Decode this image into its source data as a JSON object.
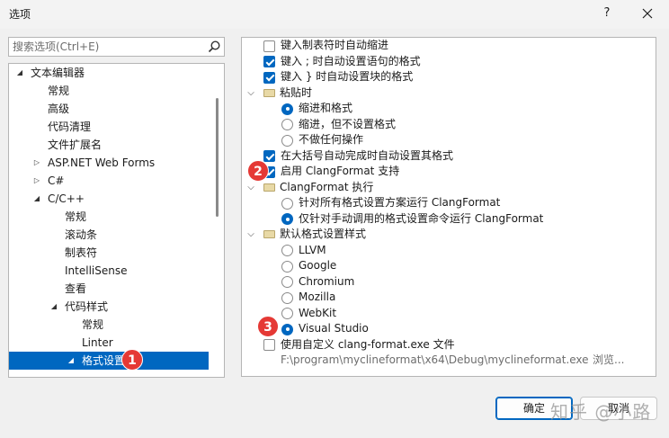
{
  "window": {
    "title": "选项",
    "help_glyph": "?",
    "close_icon": "close-icon"
  },
  "search": {
    "placeholder": "搜索选项(Ctrl+E)",
    "icon": "search-icon"
  },
  "tree": {
    "items": [
      {
        "label": "文本编辑器",
        "arrow": "◢"
      },
      {
        "label": "常规",
        "arrow": ""
      },
      {
        "label": "高级",
        "arrow": ""
      },
      {
        "label": "代码清理",
        "arrow": ""
      },
      {
        "label": "文件扩展名",
        "arrow": ""
      },
      {
        "label": "ASP.NET Web Forms",
        "arrow": "▷"
      },
      {
        "label": "C#",
        "arrow": "▷"
      },
      {
        "label": "C/C++",
        "arrow": "◢"
      },
      {
        "label": "常规",
        "arrow": ""
      },
      {
        "label": "滚动条",
        "arrow": ""
      },
      {
        "label": "制表符",
        "arrow": ""
      },
      {
        "label": "IntelliSense",
        "arrow": ""
      },
      {
        "label": "查看",
        "arrow": ""
      },
      {
        "label": "代码样式",
        "arrow": "◢"
      },
      {
        "label": "常规",
        "arrow": ""
      },
      {
        "label": "Linter",
        "arrow": ""
      },
      {
        "label": "格式设置",
        "arrow": "◢"
      }
    ],
    "selected_index": 16
  },
  "options": [
    {
      "type": "checkbox",
      "checked": false,
      "label": "键入制表符时自动缩进"
    },
    {
      "type": "checkbox",
      "checked": true,
      "label": "键入 ; 时自动设置语句的格式"
    },
    {
      "type": "checkbox",
      "checked": true,
      "label": "键入 } 时自动设置块的格式"
    },
    {
      "type": "group",
      "label": "粘贴时"
    },
    {
      "type": "radio",
      "checked": true,
      "label": "缩进和格式"
    },
    {
      "type": "radio",
      "checked": false,
      "label": "缩进，但不设置格式"
    },
    {
      "type": "radio",
      "checked": false,
      "label": "不做任何操作"
    },
    {
      "type": "checkbox",
      "checked": true,
      "label": "在大括号自动完成时自动设置其格式"
    },
    {
      "type": "checkbox",
      "checked": true,
      "label": "启用 ClangFormat 支持"
    },
    {
      "type": "group",
      "label": "ClangFormat 执行"
    },
    {
      "type": "radio",
      "checked": false,
      "label": "针对所有格式设置方案运行 ClangFormat"
    },
    {
      "type": "radio",
      "checked": true,
      "label": "仅针对手动调用的格式设置命令运行 ClangFormat"
    },
    {
      "type": "group",
      "label": "默认格式设置样式"
    },
    {
      "type": "radio",
      "checked": false,
      "label": "LLVM"
    },
    {
      "type": "radio",
      "checked": false,
      "label": "Google"
    },
    {
      "type": "radio",
      "checked": false,
      "label": "Chromium"
    },
    {
      "type": "radio",
      "checked": false,
      "label": "Mozilla"
    },
    {
      "type": "radio",
      "checked": false,
      "label": "WebKit"
    },
    {
      "type": "radio",
      "checked": true,
      "label": "Visual Studio"
    },
    {
      "type": "checkbox",
      "checked": false,
      "label": "使用自定义 clang-format.exe 文件"
    },
    {
      "type": "path",
      "label": "F:\\program\\myclineformat\\x64\\Debug\\myclineformat.exe",
      "browse": "浏览..."
    }
  ],
  "badges": [
    "1",
    "2",
    "3"
  ],
  "buttons": {
    "ok": "确定",
    "cancel": "取消"
  },
  "watermark": "知乎 @小路",
  "colors": {
    "accent": "#0067c0",
    "badge": "#e53935"
  }
}
